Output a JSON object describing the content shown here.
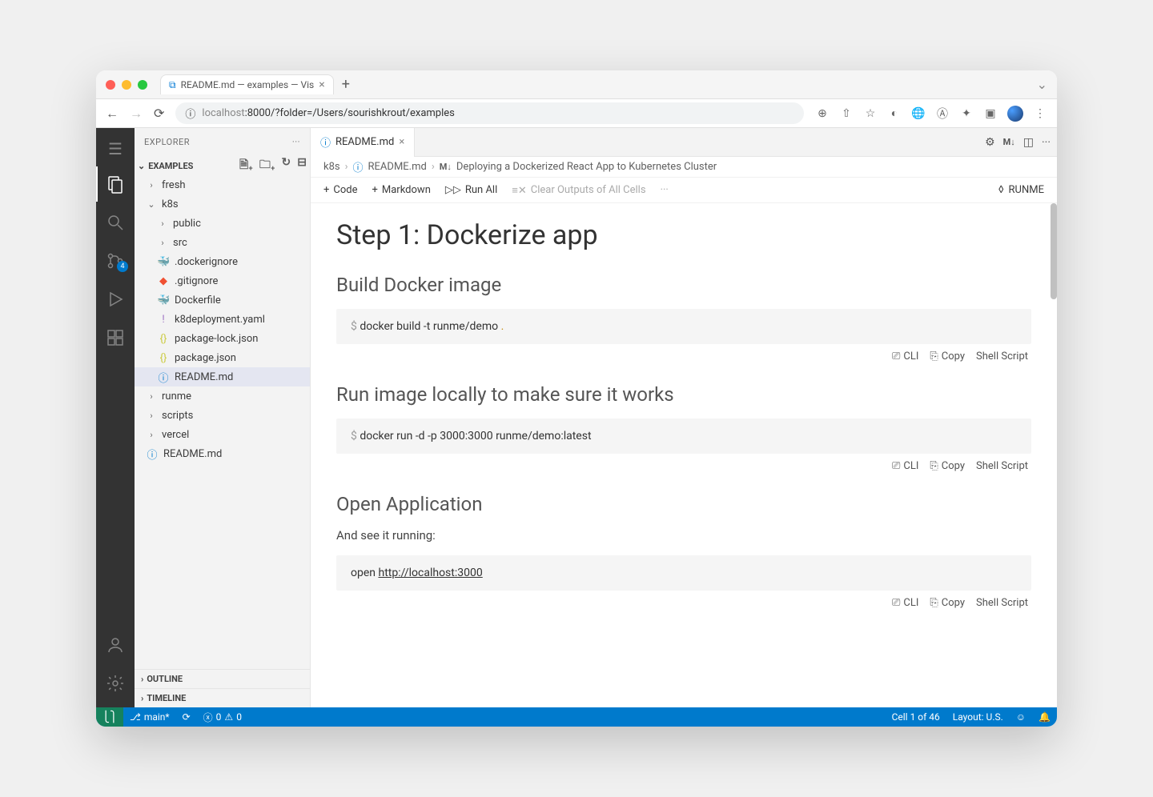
{
  "browser": {
    "tab_title": "README.md — examples — Vis",
    "url_info_icon": "ⓘ",
    "url_host": "localhost",
    "url_port_path": ":8000/?folder=/Users/sourishkrout/examples"
  },
  "activitybar": {
    "badge_source_control": "4"
  },
  "sidebar": {
    "title": "EXPLORER",
    "section": "EXAMPLES",
    "tree": {
      "fresh": "fresh",
      "k8s": "k8s",
      "public": "public",
      "src": "src",
      "dockerignore": ".dockerignore",
      "gitignore": ".gitignore",
      "dockerfile": "Dockerfile",
      "k8deploy": "k8deployment.yaml",
      "pkg_lock": "package-lock.json",
      "pkg": "package.json",
      "readme": "README.md",
      "runme": "runme",
      "scripts": "scripts",
      "vercel": "vercel",
      "root_readme": "README.md"
    },
    "outline": "OUTLINE",
    "timeline": "TIMELINE"
  },
  "editor": {
    "tab": "README.md",
    "tab_action_md": "M↓",
    "breadcrumb": {
      "k8s": "k8s",
      "readme": "README.md",
      "heading_prefix": "M↓",
      "heading": "Deploying a Dockerized React App to Kubernetes Cluster"
    },
    "toolbar": {
      "code": "Code",
      "markdown": "Markdown",
      "run_all": "Run All",
      "clear": "Clear Outputs of All Cells",
      "runme": "RUNME"
    }
  },
  "content": {
    "h1": "Step 1: Dockerize app",
    "h2_1": "Build Docker image",
    "code1_prompt": "$ ",
    "code1": "docker build -t runme/demo ",
    "code1_dot": ".",
    "h2_2": "Run image locally to make sure it works",
    "code2_prompt": "$ ",
    "code2": "docker run -d -p 3000:3000 runme/demo:latest",
    "h2_3": "Open Application",
    "p1": "And see it running:",
    "code3_open": "open ",
    "code3_url": "http://localhost:3000",
    "actions": {
      "cli": "CLI",
      "copy": "Copy",
      "shell": "Shell Script"
    }
  },
  "statusbar": {
    "branch": "main*",
    "errors": "0",
    "warnings": "0",
    "cell": "Cell 1 of 46",
    "layout": "Layout: U.S."
  }
}
